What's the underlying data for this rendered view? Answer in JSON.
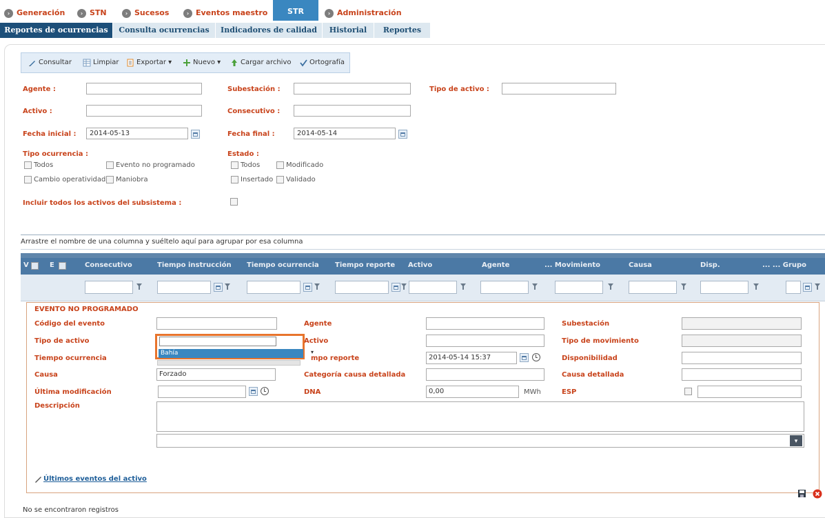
{
  "topnav": {
    "items": [
      {
        "label": "Generación"
      },
      {
        "label": "STN"
      },
      {
        "label": "Sucesos"
      },
      {
        "label": "Eventos maestro"
      },
      {
        "label": "STR"
      },
      {
        "label": "Administración"
      }
    ]
  },
  "subtabs": {
    "items": [
      {
        "label": "Reportes de ocurrencias"
      },
      {
        "label": "Consulta ocurrencias"
      },
      {
        "label": "Indicadores de calidad"
      },
      {
        "label": "Historial"
      },
      {
        "label": "Reportes"
      }
    ]
  },
  "toolbar": {
    "consultar": "Consultar",
    "limpiar": "Limpiar",
    "exportar": "Exportar ▾",
    "nuevo": "Nuevo ▾",
    "cargar": "Cargar archivo",
    "ortografia": "Ortografía"
  },
  "filters": {
    "agente": "Agente :",
    "subestacion": "Subestación :",
    "tipo_activo": "Tipo de activo :",
    "activo": "Activo :",
    "consecutivo": "Consecutivo :",
    "fecha_inicial": "Fecha inicial :",
    "fecha_inicial_value": "2014-05-13",
    "fecha_final": "Fecha final :",
    "fecha_final_value": "2014-05-14",
    "tipo_ocurrencia": "Tipo ocurrencia :",
    "estado": "Estado :",
    "incluir": "Incluir todos los activos del subsistema :",
    "tipo_options": [
      "Todos",
      "Evento no programado",
      "Cambio operatividad",
      "Maniobra"
    ],
    "estado_options": [
      "Todos",
      "Modificado",
      "Insertado",
      "Validado"
    ]
  },
  "grid": {
    "group_hint": "Arrastre el nombre de una columna y suéltelo aquí para agrupar por esa columna",
    "v_label": "V",
    "e_label": "E",
    "columns": [
      "Consecutivo",
      "Tiempo instrucción",
      "Tiempo ocurrencia",
      "Tiempo reporte",
      "Activo",
      "Agente",
      "... Movimiento",
      "Causa",
      "Disp.",
      "... ... Grupo"
    ]
  },
  "detail": {
    "title": "EVENTO NO PROGRAMADO",
    "codigo": "Código del evento",
    "tipo_activo": "Tipo de activo",
    "tiempo_ocurrencia": "Tiempo ocurrencia",
    "causa": "Causa",
    "causa_value": "Forzado",
    "ultima_mod": "Última modificación",
    "descripcion": "Descripción",
    "agente": "Agente",
    "activo": "Activo",
    "tiempo_reporte": "mpo reporte",
    "tiempo_reporte_value": "2014-05-14 15:37",
    "cat_causa": "Categoría causa detallada",
    "dna": "DNA",
    "dna_value": "0,00",
    "dna_unit": "MWh",
    "subestacion": "Subestación",
    "tipo_mov": "Tipo de movimiento",
    "disponibilidad": "Disponibilidad",
    "causa_det": "Causa detallada",
    "esp": "ESP",
    "dropdown_option": "Bahía",
    "ultimos_link": "Últimos eventos del activo"
  },
  "status": {
    "text": "No se encontraron registros"
  },
  "colors": {
    "accent_orange": "#c8431b",
    "nav_blue": "#3a87c0",
    "tab_dark": "#1d4f79",
    "grid_header": "#4b79a5",
    "highlight": "#e8742c"
  }
}
